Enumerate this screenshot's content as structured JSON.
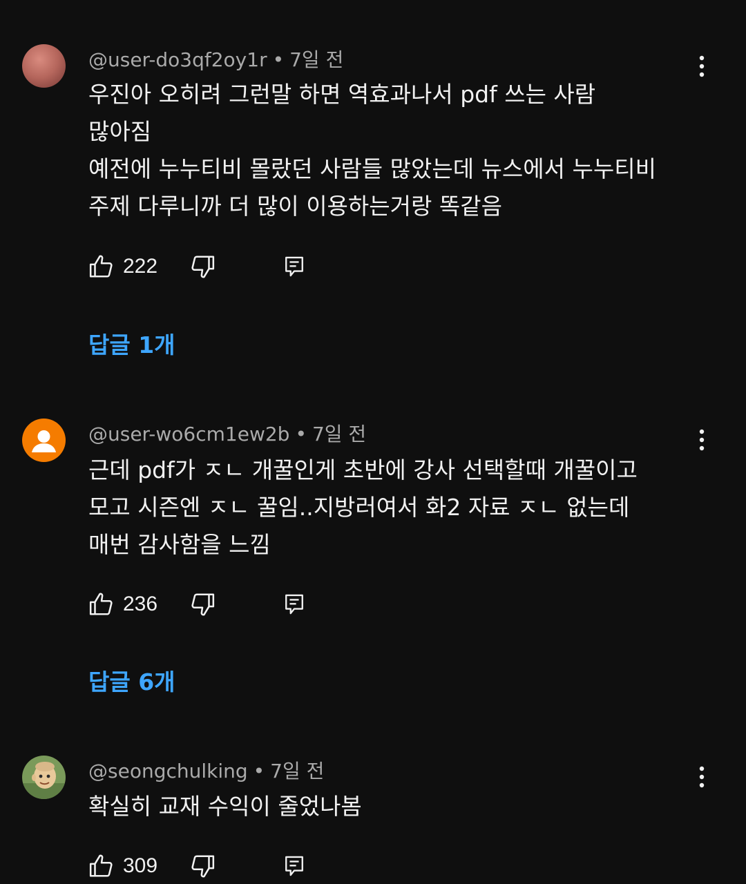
{
  "comments": [
    {
      "author": "@user-do3qf2oy1r",
      "separator": "•",
      "time": "7일 전",
      "lines": [
        "우진아 오히려 그런말 하면 역효과나서 pdf 쓰는 사람",
        "많아짐",
        "예전에 누누티비 몰랐던 사람들 많았는데 뉴스에서 누누티비",
        "주제 다루니까 더 많이 이용하는거랑 똑같음"
      ],
      "likes": "222",
      "replies": "답글 1개"
    },
    {
      "author": "@user-wo6cm1ew2b",
      "separator": "•",
      "time": "7일 전",
      "lines": [
        "근데 pdf가 ㅈㄴ 개꿀인게 초반에 강사 선택할때 개꿀이고",
        "모고 시즌엔 ㅈㄴ 꿀임..지방러여서 화2 자료 ㅈㄴ 없는데",
        "매번 감사함을 느낌"
      ],
      "likes": "236",
      "replies": "답글 6개"
    },
    {
      "author": "@seongchulking",
      "separator": "•",
      "time": "7일 전",
      "lines": [
        "확실히 교재 수익이 줄었나봄"
      ],
      "likes": "309"
    }
  ],
  "icons": {
    "like": "thumbs-up-icon",
    "dislike": "thumbs-down-icon",
    "reply": "reply-icon",
    "more": "more-vert-icon"
  },
  "colors": {
    "background": "#0f0f0f",
    "text": "#f1f1f1",
    "secondary": "#aaaaaa",
    "link": "#3ea6ff",
    "avatar_default": "#f57c00"
  }
}
